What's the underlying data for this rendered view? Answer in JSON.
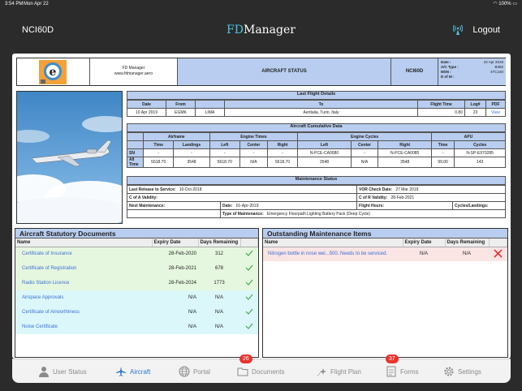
{
  "status_bar": {
    "time": "3:54 PM",
    "date": "Mon Apr 22",
    "battery": "100%"
  },
  "header": {
    "tail_number": "NCI60D",
    "brand_fd": "FD",
    "brand_rest": "Manager",
    "logout_label": "Logout"
  },
  "top_card": {
    "company": "FD Manager",
    "website": "www.fdmanager.aero",
    "title": "AIRCRAFT STATUS",
    "tail": "NCI60D",
    "date_label": "Date :",
    "date_value": "22 Apr 2019",
    "actype_label": "A/C Type :",
    "actype_value": "B350",
    "msn_label": "MSN :",
    "msn_value": "4TC160",
    "dofm_label": "D of M :",
    "dofm_value": ""
  },
  "last_flight": {
    "title": "Last Flight Details",
    "headers": [
      "Date",
      "From",
      "",
      "To",
      "Flight Time",
      "Log#",
      "PDF"
    ],
    "row": [
      "10 Apr 2019",
      "EGMK",
      "LIMA",
      "Aeritalia, Turin, Italy",
      "0.80",
      "23",
      "View"
    ]
  },
  "cumulative": {
    "title": "Aircraft Cumulative Data",
    "groups": [
      "Airframe",
      "Engine Times",
      "Engine Cycles",
      "APU"
    ],
    "sub": [
      "Time",
      "Landings",
      "Left",
      "Center",
      "Right",
      "Left",
      "Center",
      "Right",
      "Time",
      "Cycles"
    ],
    "sn_label": "SN",
    "sn": [
      "-",
      "-",
      "-",
      "-",
      "-",
      "N-PCE-CA0080",
      "-",
      "N-PCE-CA0085",
      "-",
      "N-SP-E970285"
    ],
    "all_label": "All Time",
    "all": [
      "5618.70",
      "3548",
      "5618.70",
      "N/A",
      "5618.70",
      "3548",
      "N/A",
      "3548",
      "99.00",
      "143"
    ]
  },
  "maintenance": {
    "title": "Maintenance Status",
    "last_release_label": "Last Release to Service:",
    "last_release_value": "10-Oct-2018",
    "vor_label": "VOR Check Date:",
    "vor_value": "27 Mar 2019",
    "coa_label": "C of A Validity:",
    "coa_value": "",
    "cor_label": "C of R Validity:",
    "cor_value": "28-Feb-2021",
    "next_label": "Next Maintenance:",
    "next_date_label": "Date:",
    "next_date_value": "01-Apr-2019",
    "flight_hours_label": "Flight Hours:",
    "flight_hours_value": "",
    "cycles_label": "Cycles/Landings:",
    "cycles_value": "",
    "type_label": "Type of Maintenance:",
    "type_value": "Emergency Floorpath Lighting Battery Pack (Deep Cycle)"
  },
  "statutory": {
    "title": "Aircraft Statutory Documents",
    "headers": [
      "Name",
      "Expiry Date",
      "Days Remaining"
    ],
    "rows": [
      {
        "name": "Certificate of Insurance",
        "expiry": "28-Feb-2020",
        "days": "312",
        "color": "g"
      },
      {
        "name": "Certificate of Registration",
        "expiry": "28-Feb-2021",
        "days": "678",
        "color": "g"
      },
      {
        "name": "Radio Station Licence",
        "expiry": "28-Feb-2024",
        "days": "1773",
        "color": "g"
      },
      {
        "name": "Airspace Approvals",
        "expiry": "N/A",
        "days": "N/A",
        "color": "b"
      },
      {
        "name": "Certificate of Airworthiness",
        "expiry": "N/A",
        "days": "N/A",
        "color": "b"
      },
      {
        "name": "Noise Certificate",
        "expiry": "N/A",
        "days": "N/A",
        "color": "b"
      }
    ]
  },
  "outstanding": {
    "title": "Outstanding Maintenance Items",
    "headers": [
      "Name",
      "Expiry Date",
      "Days Remaining"
    ],
    "rows": [
      {
        "name": "Nitrogen bottle in nose wel...500. Needs to be serviced.",
        "expiry": "N/A",
        "days": "N/A"
      }
    ]
  },
  "tabs": [
    {
      "label": "User Status",
      "icon": "users-icon",
      "active": false,
      "badge": ""
    },
    {
      "label": "Aircraft",
      "icon": "plane-icon",
      "active": true,
      "badge": ""
    },
    {
      "label": "Portal",
      "icon": "globe-icon",
      "active": false,
      "badge": ""
    },
    {
      "label": "Documents",
      "icon": "folder-icon",
      "active": false,
      "badge": "26"
    },
    {
      "label": "Flight Plan",
      "icon": "flight-plan-icon",
      "active": false,
      "badge": ""
    },
    {
      "label": "Forms",
      "icon": "forms-icon",
      "active": false,
      "badge": "37"
    },
    {
      "label": "Settings",
      "icon": "gear-icon",
      "active": false,
      "badge": ""
    }
  ],
  "colors": {
    "accent": "#2a7ac8",
    "header_blue": "#b8cdef",
    "check": "#35a33a",
    "cross": "#e8342c"
  }
}
